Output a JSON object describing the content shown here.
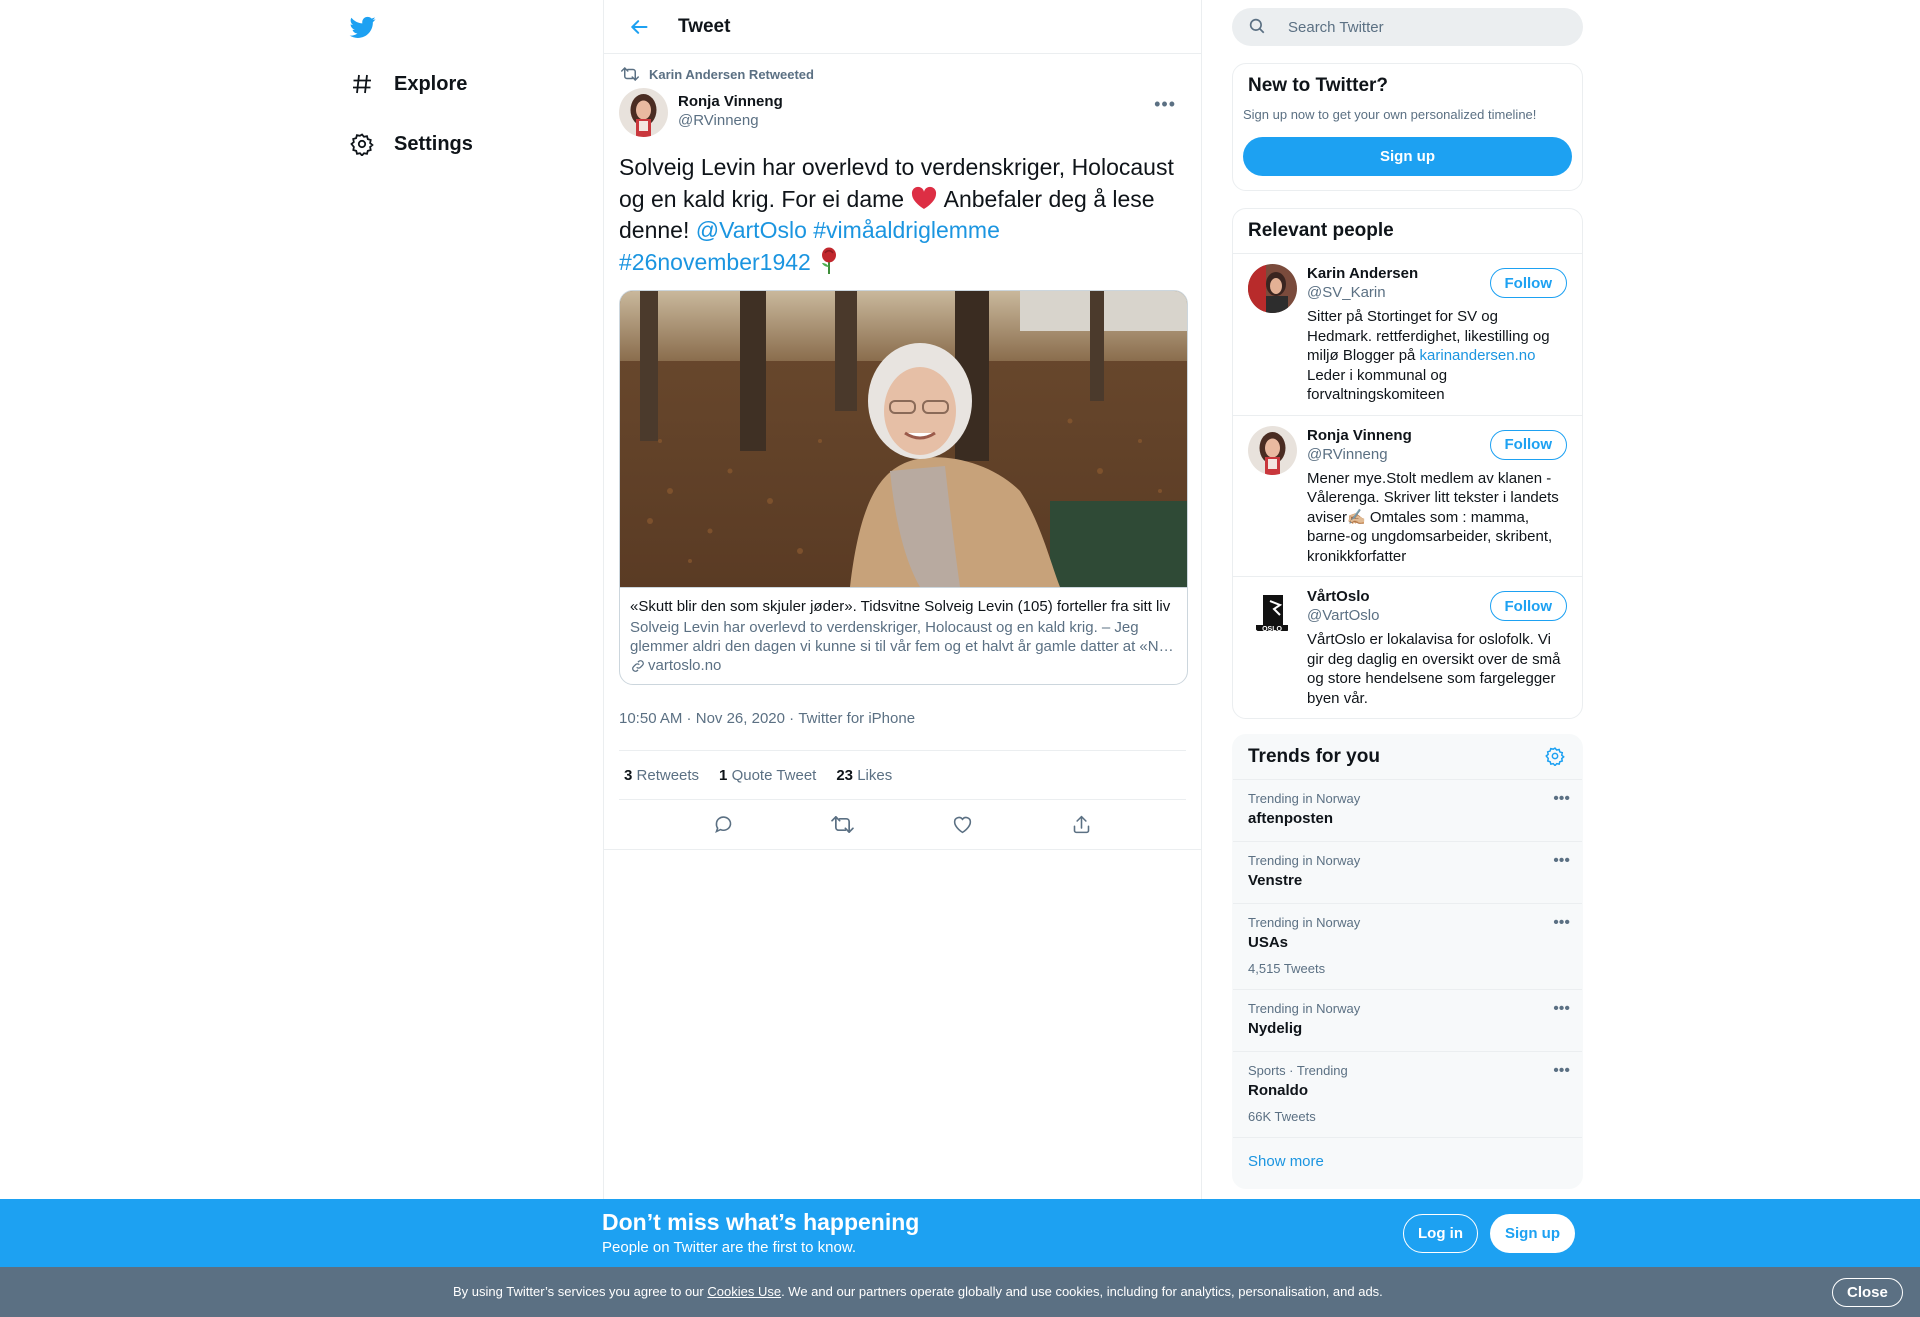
{
  "nav": {
    "logo": "twitter-bird-icon",
    "items": [
      {
        "label": "Explore",
        "icon": "hashtag-icon"
      },
      {
        "label": "Settings",
        "icon": "gear-icon"
      }
    ]
  },
  "header": {
    "title": "Tweet",
    "back_icon": "arrow-left-icon"
  },
  "tweet": {
    "retweeted_by": "Karin Andersen Retweeted",
    "author_name": "Ronja Vinneng",
    "author_handle": "@RVinneng",
    "text_part1": "Solveig Levin har overlevd to verdenskriger, Holocaust og en kald krig. For ei dame ",
    "text_part2": " Anbefaler deg å lese denne! ",
    "mention": "@VartOslo",
    "hashtag1": "#vimåaldriglemme",
    "hashtag2": "#26november1942",
    "card": {
      "title": "«Skutt blir den som skjuler jøder». Tidsvitne Solveig Levin (105) forteller fra sitt liv",
      "description": "Solveig Levin har overlevd to verdenskriger, Holocaust og en kald krig. – Jeg glemmer aldri den dagen vi kunne si til vår fem og et halvt år gamle datter at «N…",
      "domain": "vartoslo.no"
    },
    "time": "10:50 AM",
    "separator": " · ",
    "date": "Nov 26, 2020",
    "source": "Twitter for iPhone",
    "retweets_count": "3",
    "retweets_label": "Retweets",
    "quotes_count": "1",
    "quotes_label": "Quote Tweet",
    "likes_count": "23",
    "likes_label": "Likes"
  },
  "search": {
    "placeholder": "Search Twitter"
  },
  "new_to_twitter": {
    "title": "New to Twitter?",
    "subtitle": "Sign up now to get your own personalized timeline!",
    "button": "Sign up"
  },
  "relevant_people": {
    "title": "Relevant people",
    "people": [
      {
        "name": "Karin Andersen",
        "handle": "@SV_Karin",
        "bio_a": "Sitter på Stortinget for SV og Hedmark. rettferdighet, likestilling og miljø Blogger på ",
        "bio_link": "karinandersen.no",
        "bio_b": " Leder i kommunal og forvaltningskomiteen",
        "button": "Follow"
      },
      {
        "name": "Ronja Vinneng",
        "handle": "@RVinneng",
        "bio_a": "Mener mye.Stolt medlem av klanen - Vålerenga. Skriver litt tekster i landets aviser✍🏼 Omtales som : mamma, barne-og ungdomsarbeider, skribent, kronikkforfatter",
        "button": "Follow"
      },
      {
        "name": "VårtOslo",
        "handle": "@VartOslo",
        "bio_a": "VårtOslo er lokalavisa for oslofolk. Vi gir deg daglig en oversikt over de små og store hendelsene som fargelegger byen vår.",
        "button": "Follow"
      }
    ]
  },
  "trends": {
    "title": "Trends for you",
    "items": [
      {
        "context": "Trending in Norway",
        "name": "aftenposten",
        "count": ""
      },
      {
        "context": "Trending in Norway",
        "name": "Venstre",
        "count": ""
      },
      {
        "context": "Trending in Norway",
        "name": "USAs",
        "count": "4,515 Tweets"
      },
      {
        "context": "Trending in Norway",
        "name": "Nydelig",
        "count": ""
      },
      {
        "context": "Sports · Trending",
        "name": "Ronaldo",
        "count": "66K Tweets"
      }
    ],
    "show_more": "Show more"
  },
  "bottom_bar": {
    "title": "Don’t miss what’s happening",
    "subtitle": "People on Twitter are the first to know.",
    "login": "Log in",
    "signup": "Sign up"
  },
  "cookie": {
    "text_before": "By using Twitter’s services you agree to our ",
    "link": "Cookies Use",
    "text_after": ". We and our partners operate globally and use cookies, including for analytics, personalisation, and ads.",
    "close": "Close"
  },
  "colors": {
    "accent": "#1da1f2",
    "link": "#1b95e0",
    "secondary_text": "#5b7083",
    "border": "#ebeef0",
    "cookie_bar": "#5b7083"
  }
}
